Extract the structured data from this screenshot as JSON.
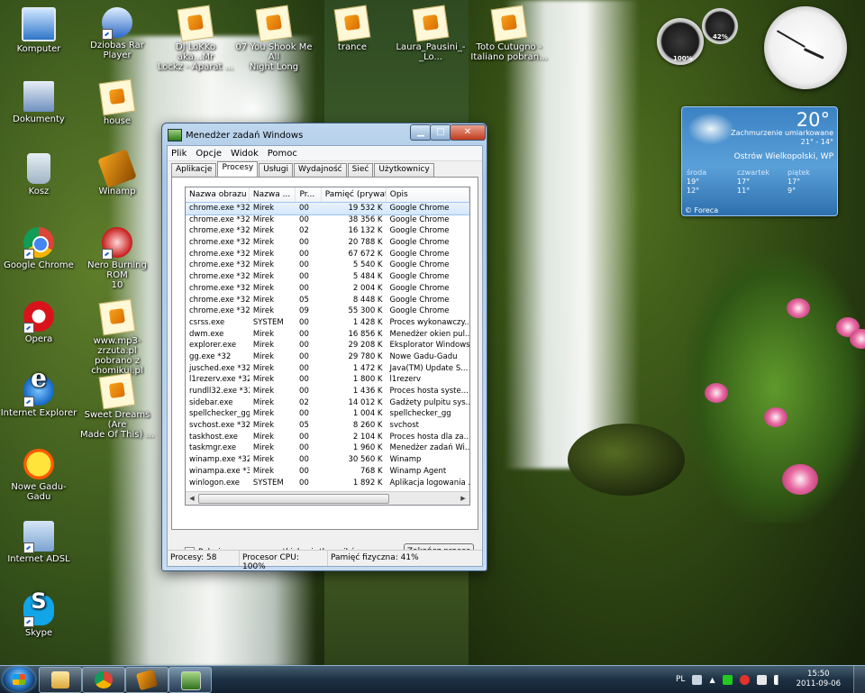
{
  "desktop": {
    "icons": [
      {
        "label": "Komputer"
      },
      {
        "label": "Dziobas Rar Player"
      },
      {
        "label": "DJ LoKKo aka...Mr\nLockz - Aparat ..."
      },
      {
        "label": "07 You Shook Me All\nNight Long"
      },
      {
        "label": "trance"
      },
      {
        "label": "Laura_Pausini_-_Lo..."
      },
      {
        "label": "Toto Cutugno - \nItaliano pobran..."
      },
      {
        "label": "Dokumenty"
      },
      {
        "label": "house"
      },
      {
        "label": "Kosz"
      },
      {
        "label": "Winamp"
      },
      {
        "label": "Google Chrome"
      },
      {
        "label": "Nero Burning ROM\n10"
      },
      {
        "label": "Opera"
      },
      {
        "label": "www.mp3-zrzuta.pl \npobrano z chomikuj.pl"
      },
      {
        "label": "Internet Explorer"
      },
      {
        "label": "Sweet Dreams (Are\nMade Of This) ..."
      },
      {
        "label": "Nowe Gadu-Gadu"
      },
      {
        "label": "Internet ADSL"
      },
      {
        "label": "Skype"
      }
    ]
  },
  "gadgets": {
    "cpu_gauge": {
      "percent_label": "100%"
    },
    "memory_gauge": {
      "percent_label": "42%"
    },
    "clock": {
      "hour": 15,
      "minute": 50
    },
    "weather": {
      "temperature": "20°",
      "condition": "Zachmurzenie umiarkowane",
      "range": "21° - 14°",
      "city": "Ostrów Wielkopolski, WP",
      "days": [
        {
          "name": "środa",
          "high": "19°",
          "low": "12°"
        },
        {
          "name": "czwartek",
          "high": "17°",
          "low": "11°"
        },
        {
          "name": "piątek",
          "high": "17°",
          "low": "9°"
        }
      ],
      "provider": "© Foreca"
    }
  },
  "task_manager": {
    "title": "Menedżer zadań Windows",
    "menu": [
      "Plik",
      "Opcje",
      "Widok",
      "Pomoc"
    ],
    "tabs": [
      "Aplikacje",
      "Procesy",
      "Usługi",
      "Wydajność",
      "Sieć",
      "Użytkownicy"
    ],
    "active_tab": "Procesy",
    "columns": [
      "Nazwa obrazu",
      "Nazwa ...",
      "Pr...",
      "Pamięć (prywatn...",
      "Opis"
    ],
    "processes": [
      [
        "chrome.exe *32",
        "Mirek",
        "00",
        "19 532 K",
        "Google Chrome"
      ],
      [
        "chrome.exe *32",
        "Mirek",
        "00",
        "38 356 K",
        "Google Chrome"
      ],
      [
        "chrome.exe *32",
        "Mirek",
        "02",
        "16 132 K",
        "Google Chrome"
      ],
      [
        "chrome.exe *32",
        "Mirek",
        "00",
        "20 788 K",
        "Google Chrome"
      ],
      [
        "chrome.exe *32",
        "Mirek",
        "00",
        "67 672 K",
        "Google Chrome"
      ],
      [
        "chrome.exe *32",
        "Mirek",
        "00",
        "5 540 K",
        "Google Chrome"
      ],
      [
        "chrome.exe *32",
        "Mirek",
        "00",
        "5 484 K",
        "Google Chrome"
      ],
      [
        "chrome.exe *32",
        "Mirek",
        "00",
        "2 004 K",
        "Google Chrome"
      ],
      [
        "chrome.exe *32",
        "Mirek",
        "05",
        "8 448 K",
        "Google Chrome"
      ],
      [
        "chrome.exe *32",
        "Mirek",
        "09",
        "55 300 K",
        "Google Chrome"
      ],
      [
        "csrss.exe",
        "SYSTEM",
        "00",
        "1 428 K",
        "Proces wykonawczy..."
      ],
      [
        "dwm.exe",
        "Mirek",
        "00",
        "16 856 K",
        "Menedżer okien pul..."
      ],
      [
        "explorer.exe",
        "Mirek",
        "00",
        "29 208 K",
        "Eksplorator Windows"
      ],
      [
        "gg.exe *32",
        "Mirek",
        "00",
        "29 780 K",
        "Nowe Gadu-Gadu"
      ],
      [
        "jusched.exe *32",
        "Mirek",
        "00",
        "1 472 K",
        "Java(TM) Update S..."
      ],
      [
        "l1rezerv.exe *32",
        "Mirek",
        "00",
        "1 800 K",
        "l1rezerv"
      ],
      [
        "rundll32.exe *32",
        "Mirek",
        "00",
        "1 436 K",
        "Proces hosta syste..."
      ],
      [
        "sidebar.exe",
        "Mirek",
        "02",
        "14 012 K",
        "Gadżety pulpitu sys..."
      ],
      [
        "spellchecker_gg...",
        "Mirek",
        "00",
        "1 004 K",
        "spellchecker_gg"
      ],
      [
        "svchost.exe *32",
        "Mirek",
        "05",
        "8 260 K",
        "svchost"
      ],
      [
        "taskhost.exe",
        "Mirek",
        "00",
        "2 104 K",
        "Proces hosta dla za..."
      ],
      [
        "taskmgr.exe",
        "Mirek",
        "00",
        "1 960 K",
        "Menedżer zadań Wi..."
      ],
      [
        "winamp.exe *32",
        "Mirek",
        "00",
        "30 560 K",
        "Winamp"
      ],
      [
        "winampa.exe *32",
        "Mirek",
        "00",
        "768 K",
        "Winamp Agent"
      ],
      [
        "winlogon.exe",
        "SYSTEM",
        "00",
        "1 892 K",
        "Aplikacja logowania ..."
      ]
    ],
    "show_all_users_label": "Pokaż procesy wszystkich użytkowników",
    "end_process_label": "Zakończ proces",
    "status": {
      "processes": "Procesy: 58",
      "cpu": "Procesor CPU: 100%",
      "memory": "Pamięć fizyczna: 41%"
    }
  },
  "taskbar": {
    "language": "PL",
    "time": "15:50",
    "date": "2011-09-06"
  }
}
